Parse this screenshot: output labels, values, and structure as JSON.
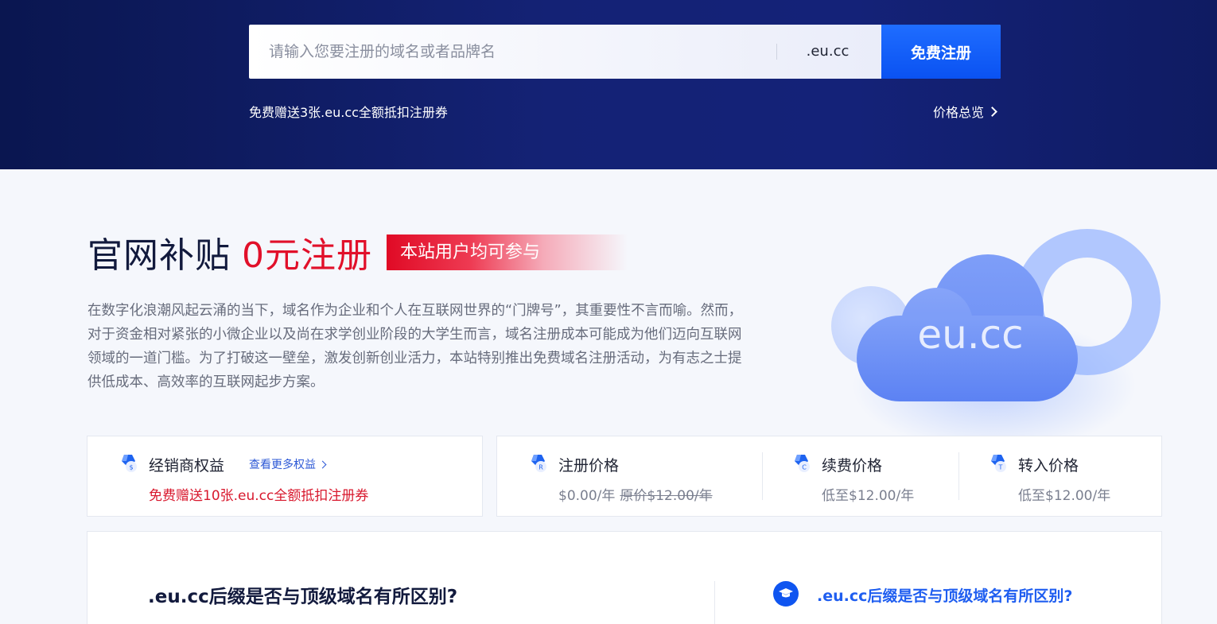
{
  "hero": {
    "search_placeholder": "请输入您要注册的域名或者品牌名",
    "suffix": ".eu.cc",
    "register_label": "免费注册",
    "promo_text": "免费赠送3张.eu.cc全额抵扣注册券",
    "price_overview_label": "价格总览"
  },
  "intro": {
    "title_main": "官网补贴",
    "title_highlight": "0元注册",
    "tag": "本站用户均可参与",
    "description": "在数字化浪潮风起云涌的当下，域名作为企业和个人在互联网世界的“门牌号”，其重要性不言而喻。然而，对于资金相对紧张的小微企业以及尚在求学创业阶段的大学生而言，域名注册成本可能成为他们迈向互联网领域的一道门槛。为了打破这一壁垒，激发创新创业活力，本站特别推出免费域名注册活动，为有志之士提供低成本、高效率的互联网起步方案。",
    "illustration_text": "eu.cc"
  },
  "benefits": {
    "dealer_title": "经销商权益",
    "more_link": "查看更多权益",
    "dealer_promo": "免费赠送10张.eu.cc全额抵扣注册券",
    "prices": [
      {
        "title": "注册价格",
        "value": "$0.00/年",
        "original": "原价$12.00/年",
        "badge": "R"
      },
      {
        "title": "续费价格",
        "value": "低至$12.00/年",
        "original": "",
        "badge": "C"
      },
      {
        "title": "转入价格",
        "value": "低至$12.00/年",
        "original": "",
        "badge": "T"
      }
    ]
  },
  "faq": {
    "question": ".eu.cc后缀是否与顶级域名有所区别?",
    "link": ".eu.cc后缀是否与顶级域名有所区别?"
  },
  "colors": {
    "hero_bg": "#0f1b62",
    "accent_blue": "#0a52f2",
    "accent_red": "#e1102a"
  }
}
